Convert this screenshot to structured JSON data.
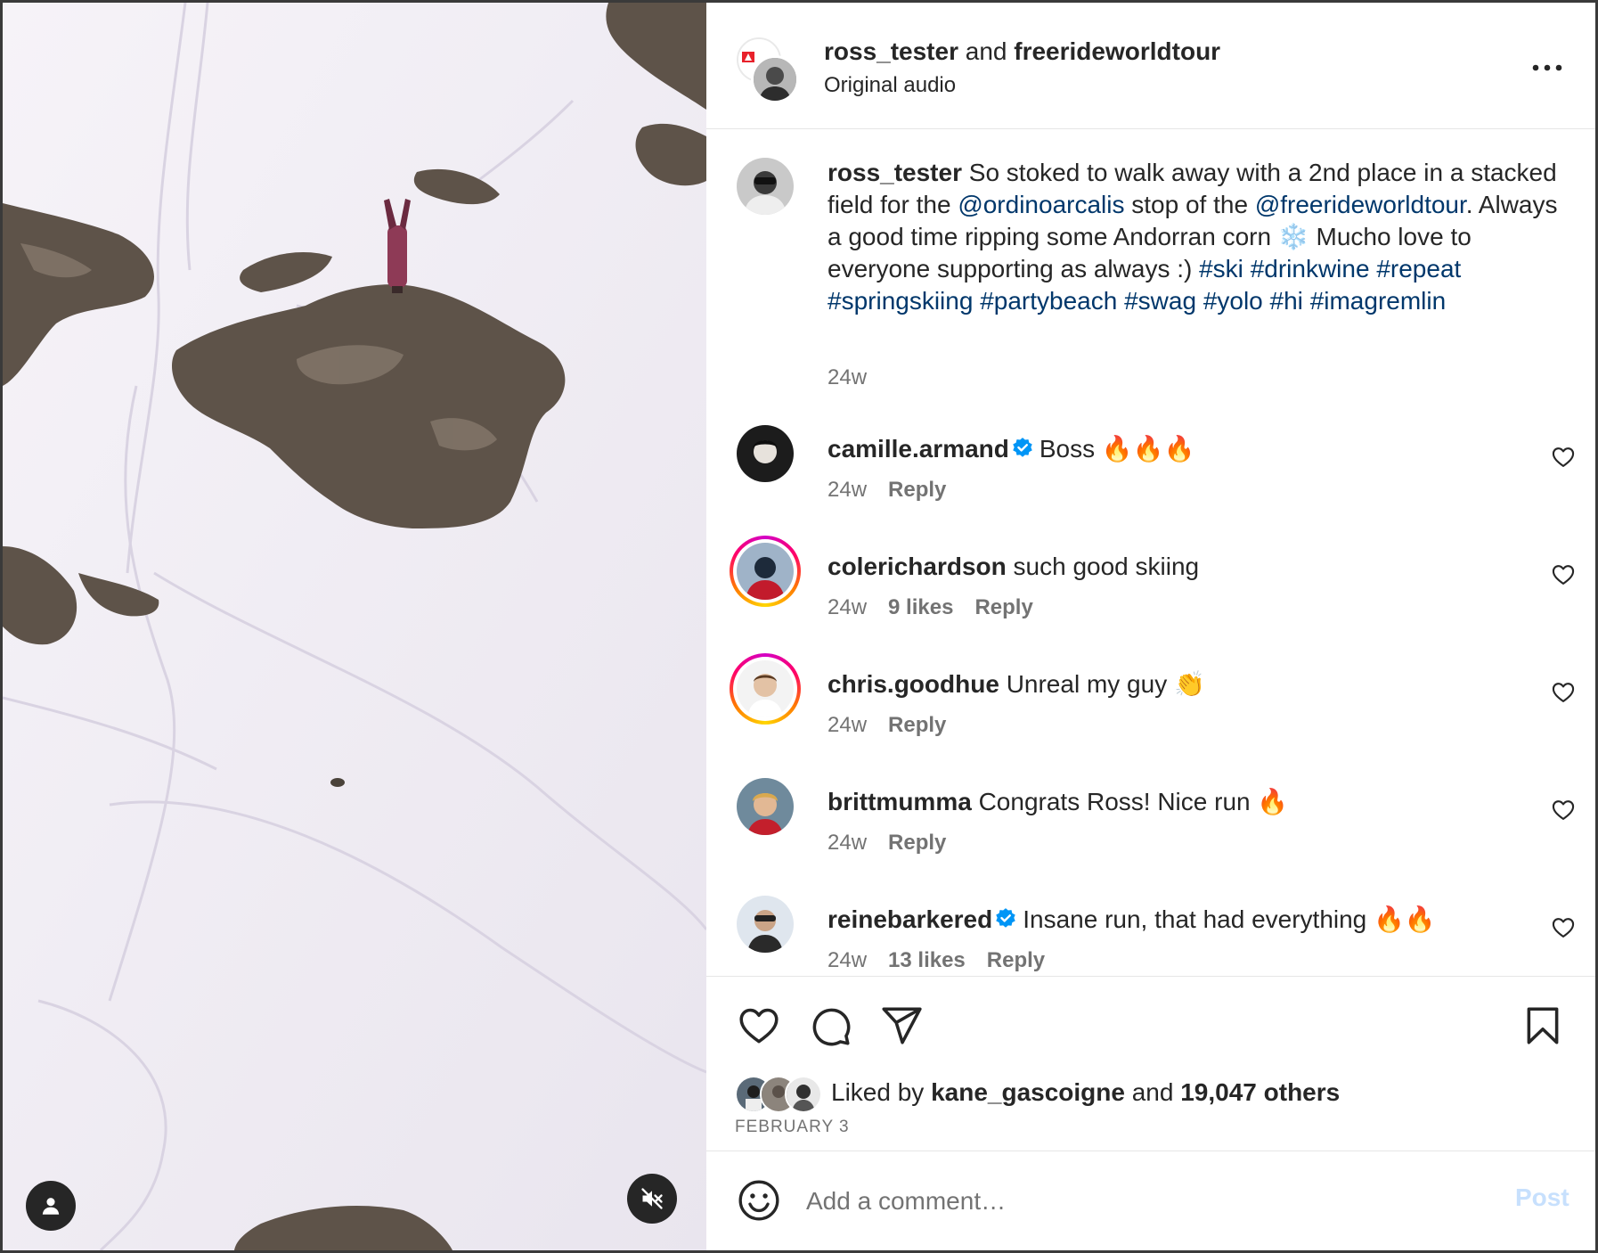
{
  "post": {
    "header": {
      "author": "ross_tester",
      "and_text": "and",
      "collaborator": "freerideworldtour",
      "audio_label": "Original audio",
      "more_icon": "more-horizontal-icon"
    },
    "caption": {
      "username": "ross_tester",
      "segments": [
        {
          "type": "text",
          "value": " So stoked to walk away with a 2nd place in a stacked field for the "
        },
        {
          "type": "link",
          "value": "@ordinoarcalis"
        },
        {
          "type": "text",
          "value": " stop of the "
        },
        {
          "type": "link",
          "value": "@freerideworldtour"
        },
        {
          "type": "text",
          "value": ". Always a good time ripping some Andorran corn ❄️ Mucho love to everyone supporting as always :) "
        },
        {
          "type": "link",
          "value": "#ski"
        },
        {
          "type": "text",
          "value": " "
        },
        {
          "type": "link",
          "value": "#drinkwine"
        },
        {
          "type": "text",
          "value": " "
        },
        {
          "type": "link",
          "value": "#repeat"
        },
        {
          "type": "text",
          "value": " "
        },
        {
          "type": "link",
          "value": "#springskiing"
        },
        {
          "type": "text",
          "value": " "
        },
        {
          "type": "link",
          "value": "#partybeach"
        },
        {
          "type": "text",
          "value": " "
        },
        {
          "type": "link",
          "value": "#swag"
        },
        {
          "type": "text",
          "value": " "
        },
        {
          "type": "link",
          "value": "#yolo"
        },
        {
          "type": "text",
          "value": " "
        },
        {
          "type": "link",
          "value": "#hi"
        },
        {
          "type": "text",
          "value": " "
        },
        {
          "type": "link",
          "value": "#imagremlin"
        }
      ],
      "time": "24w"
    },
    "comments": [
      {
        "username": "camille.armand",
        "verified": true,
        "text": "Boss 🔥🔥🔥",
        "time": "24w",
        "likes": "",
        "reply": "Reply",
        "story_ring": false
      },
      {
        "username": "colerichardson",
        "verified": false,
        "text": "such good skiing",
        "time": "24w",
        "likes": "9 likes",
        "reply": "Reply",
        "story_ring": true
      },
      {
        "username": "chris.goodhue",
        "verified": false,
        "text": "Unreal my guy 👏",
        "time": "24w",
        "likes": "",
        "reply": "Reply",
        "story_ring": true
      },
      {
        "username": "brittmumma",
        "verified": false,
        "text": "Congrats Ross! Nice run 🔥",
        "time": "24w",
        "likes": "",
        "reply": "Reply",
        "story_ring": false
      },
      {
        "username": "reinebarkered",
        "verified": true,
        "text": "Insane run, that had everything 🔥🔥",
        "time": "24w",
        "likes": "13 likes",
        "reply": "Reply",
        "story_ring": false
      }
    ],
    "actions": {
      "icons": [
        "heart-icon",
        "comment-icon",
        "share-icon",
        "bookmark-icon"
      ]
    },
    "likes": {
      "prefix": "Liked by",
      "user": "kane_gascoigne",
      "middle": "and",
      "others": "19,047 others"
    },
    "date": "FEBRUARY 3",
    "compose": {
      "placeholder": "Add a comment…",
      "post_label": "Post",
      "emoji_icon": "smiley-icon"
    }
  },
  "colors": {
    "link": "#00376b",
    "muted": "#737373",
    "verified": "#0095f6",
    "post_button_disabled": "#c7e0fd"
  }
}
